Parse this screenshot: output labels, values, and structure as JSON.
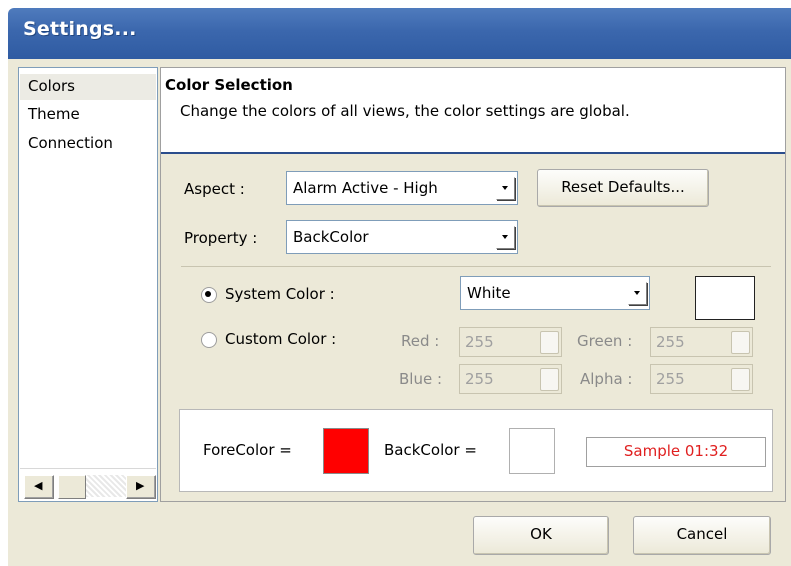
{
  "window": {
    "title": "Settings..."
  },
  "nav": {
    "items": [
      {
        "label": "Colors"
      },
      {
        "label": "Theme"
      },
      {
        "label": "Connection"
      }
    ]
  },
  "header": {
    "title": "Color Selection",
    "subtitle": "Change the colors of all views, the color settings are global."
  },
  "form": {
    "aspect_label": "Aspect :",
    "aspect_value": "Alarm Active - High",
    "reset_label": "Reset Defaults...",
    "property_label": "Property :",
    "property_value": "BackColor",
    "system_color_label": "System Color :",
    "system_color_value": "White",
    "custom_color_label": "Custom Color :",
    "red_label": "Red :",
    "red_value": "255",
    "green_label": "Green :",
    "green_value": "255",
    "blue_label": "Blue :",
    "blue_value": "255",
    "alpha_label": "Alpha :",
    "alpha_value": "255",
    "selected_mode": "system",
    "system_swatch_color": "#ffffff"
  },
  "preview": {
    "forecolor_label": "ForeColor =",
    "forecolor_color": "#ff0000",
    "backcolor_label": "BackColor =",
    "backcolor_color": "#ffffff",
    "sample_text": "Sample 01:32",
    "sample_text_color": "#e02020"
  },
  "footer": {
    "ok_label": "OK",
    "cancel_label": "Cancel"
  },
  "colors": {
    "titlebar": "#3b67ad",
    "window_bg": "#ece9d8",
    "header_rule": "#2b4d8c"
  }
}
